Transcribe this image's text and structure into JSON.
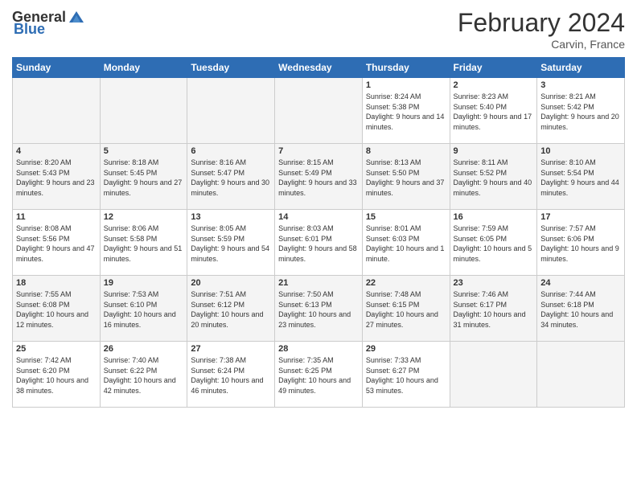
{
  "header": {
    "logo_general": "General",
    "logo_blue": "Blue",
    "title": "February 2024",
    "subtitle": "Carvin, France"
  },
  "days_of_week": [
    "Sunday",
    "Monday",
    "Tuesday",
    "Wednesday",
    "Thursday",
    "Friday",
    "Saturday"
  ],
  "weeks": [
    [
      {
        "day": "",
        "sunrise": "",
        "sunset": "",
        "daylight": ""
      },
      {
        "day": "",
        "sunrise": "",
        "sunset": "",
        "daylight": ""
      },
      {
        "day": "",
        "sunrise": "",
        "sunset": "",
        "daylight": ""
      },
      {
        "day": "",
        "sunrise": "",
        "sunset": "",
        "daylight": ""
      },
      {
        "day": "1",
        "sunrise": "Sunrise: 8:24 AM",
        "sunset": "Sunset: 5:38 PM",
        "daylight": "Daylight: 9 hours and 14 minutes."
      },
      {
        "day": "2",
        "sunrise": "Sunrise: 8:23 AM",
        "sunset": "Sunset: 5:40 PM",
        "daylight": "Daylight: 9 hours and 17 minutes."
      },
      {
        "day": "3",
        "sunrise": "Sunrise: 8:21 AM",
        "sunset": "Sunset: 5:42 PM",
        "daylight": "Daylight: 9 hours and 20 minutes."
      }
    ],
    [
      {
        "day": "4",
        "sunrise": "Sunrise: 8:20 AM",
        "sunset": "Sunset: 5:43 PM",
        "daylight": "Daylight: 9 hours and 23 minutes."
      },
      {
        "day": "5",
        "sunrise": "Sunrise: 8:18 AM",
        "sunset": "Sunset: 5:45 PM",
        "daylight": "Daylight: 9 hours and 27 minutes."
      },
      {
        "day": "6",
        "sunrise": "Sunrise: 8:16 AM",
        "sunset": "Sunset: 5:47 PM",
        "daylight": "Daylight: 9 hours and 30 minutes."
      },
      {
        "day": "7",
        "sunrise": "Sunrise: 8:15 AM",
        "sunset": "Sunset: 5:49 PM",
        "daylight": "Daylight: 9 hours and 33 minutes."
      },
      {
        "day": "8",
        "sunrise": "Sunrise: 8:13 AM",
        "sunset": "Sunset: 5:50 PM",
        "daylight": "Daylight: 9 hours and 37 minutes."
      },
      {
        "day": "9",
        "sunrise": "Sunrise: 8:11 AM",
        "sunset": "Sunset: 5:52 PM",
        "daylight": "Daylight: 9 hours and 40 minutes."
      },
      {
        "day": "10",
        "sunrise": "Sunrise: 8:10 AM",
        "sunset": "Sunset: 5:54 PM",
        "daylight": "Daylight: 9 hours and 44 minutes."
      }
    ],
    [
      {
        "day": "11",
        "sunrise": "Sunrise: 8:08 AM",
        "sunset": "Sunset: 5:56 PM",
        "daylight": "Daylight: 9 hours and 47 minutes."
      },
      {
        "day": "12",
        "sunrise": "Sunrise: 8:06 AM",
        "sunset": "Sunset: 5:58 PM",
        "daylight": "Daylight: 9 hours and 51 minutes."
      },
      {
        "day": "13",
        "sunrise": "Sunrise: 8:05 AM",
        "sunset": "Sunset: 5:59 PM",
        "daylight": "Daylight: 9 hours and 54 minutes."
      },
      {
        "day": "14",
        "sunrise": "Sunrise: 8:03 AM",
        "sunset": "Sunset: 6:01 PM",
        "daylight": "Daylight: 9 hours and 58 minutes."
      },
      {
        "day": "15",
        "sunrise": "Sunrise: 8:01 AM",
        "sunset": "Sunset: 6:03 PM",
        "daylight": "Daylight: 10 hours and 1 minute."
      },
      {
        "day": "16",
        "sunrise": "Sunrise: 7:59 AM",
        "sunset": "Sunset: 6:05 PM",
        "daylight": "Daylight: 10 hours and 5 minutes."
      },
      {
        "day": "17",
        "sunrise": "Sunrise: 7:57 AM",
        "sunset": "Sunset: 6:06 PM",
        "daylight": "Daylight: 10 hours and 9 minutes."
      }
    ],
    [
      {
        "day": "18",
        "sunrise": "Sunrise: 7:55 AM",
        "sunset": "Sunset: 6:08 PM",
        "daylight": "Daylight: 10 hours and 12 minutes."
      },
      {
        "day": "19",
        "sunrise": "Sunrise: 7:53 AM",
        "sunset": "Sunset: 6:10 PM",
        "daylight": "Daylight: 10 hours and 16 minutes."
      },
      {
        "day": "20",
        "sunrise": "Sunrise: 7:51 AM",
        "sunset": "Sunset: 6:12 PM",
        "daylight": "Daylight: 10 hours and 20 minutes."
      },
      {
        "day": "21",
        "sunrise": "Sunrise: 7:50 AM",
        "sunset": "Sunset: 6:13 PM",
        "daylight": "Daylight: 10 hours and 23 minutes."
      },
      {
        "day": "22",
        "sunrise": "Sunrise: 7:48 AM",
        "sunset": "Sunset: 6:15 PM",
        "daylight": "Daylight: 10 hours and 27 minutes."
      },
      {
        "day": "23",
        "sunrise": "Sunrise: 7:46 AM",
        "sunset": "Sunset: 6:17 PM",
        "daylight": "Daylight: 10 hours and 31 minutes."
      },
      {
        "day": "24",
        "sunrise": "Sunrise: 7:44 AM",
        "sunset": "Sunset: 6:18 PM",
        "daylight": "Daylight: 10 hours and 34 minutes."
      }
    ],
    [
      {
        "day": "25",
        "sunrise": "Sunrise: 7:42 AM",
        "sunset": "Sunset: 6:20 PM",
        "daylight": "Daylight: 10 hours and 38 minutes."
      },
      {
        "day": "26",
        "sunrise": "Sunrise: 7:40 AM",
        "sunset": "Sunset: 6:22 PM",
        "daylight": "Daylight: 10 hours and 42 minutes."
      },
      {
        "day": "27",
        "sunrise": "Sunrise: 7:38 AM",
        "sunset": "Sunset: 6:24 PM",
        "daylight": "Daylight: 10 hours and 46 minutes."
      },
      {
        "day": "28",
        "sunrise": "Sunrise: 7:35 AM",
        "sunset": "Sunset: 6:25 PM",
        "daylight": "Daylight: 10 hours and 49 minutes."
      },
      {
        "day": "29",
        "sunrise": "Sunrise: 7:33 AM",
        "sunset": "Sunset: 6:27 PM",
        "daylight": "Daylight: 10 hours and 53 minutes."
      },
      {
        "day": "",
        "sunrise": "",
        "sunset": "",
        "daylight": ""
      },
      {
        "day": "",
        "sunrise": "",
        "sunset": "",
        "daylight": ""
      }
    ]
  ]
}
